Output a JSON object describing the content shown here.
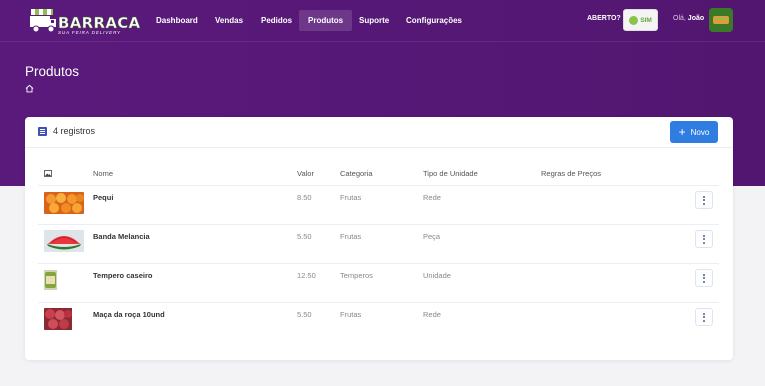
{
  "brand": {
    "name": "BARRACA",
    "tagline": "SUA FEIRA DELIVERY",
    "colors": {
      "header_bg": "#5a1a7c",
      "accent_blue": "#2f7de1",
      "open_green": "#8bc34a"
    }
  },
  "nav": {
    "items": [
      {
        "label": "Dashboard"
      },
      {
        "label": "Vendas"
      },
      {
        "label": "Pedidos"
      },
      {
        "label": "Produtos"
      },
      {
        "label": "Suporte"
      },
      {
        "label": "Configurações"
      }
    ],
    "active": "Produtos"
  },
  "status": {
    "label": "ABERTO?",
    "toggle_value": "SIM"
  },
  "user": {
    "greeting": "Olá,",
    "name": "João"
  },
  "page": {
    "title": "Produtos",
    "breadcrumb_icon": "home-icon"
  },
  "card": {
    "count_label": "4 registros",
    "list_icon": "list-icon",
    "new_button": {
      "icon": "plus-icon",
      "label": "Novo"
    }
  },
  "table": {
    "image_column_icon": "image-icon",
    "columns": [
      "Nome",
      "Valor",
      "Categoria",
      "Tipo de Unidade",
      "Regras de Preços"
    ],
    "rows": [
      {
        "image": "pequi-photo",
        "name": "Pequi",
        "price": "8.50",
        "category": "Frutas",
        "unit": "Rede"
      },
      {
        "image": "watermelon-slices-photo",
        "name": "Banda Melancia",
        "price": "5.50",
        "category": "Frutas",
        "unit": "Peça"
      },
      {
        "image": "seasoning-jar-photo",
        "name": "Tempero caseiro",
        "price": "12.50",
        "category": "Temperos",
        "unit": "Unidade"
      },
      {
        "image": "apples-net-photo",
        "name": "Maça da roça 10und",
        "price": "5.50",
        "category": "Frutas",
        "unit": "Rede"
      }
    ],
    "row_action_icon": "more-vertical-icon"
  }
}
